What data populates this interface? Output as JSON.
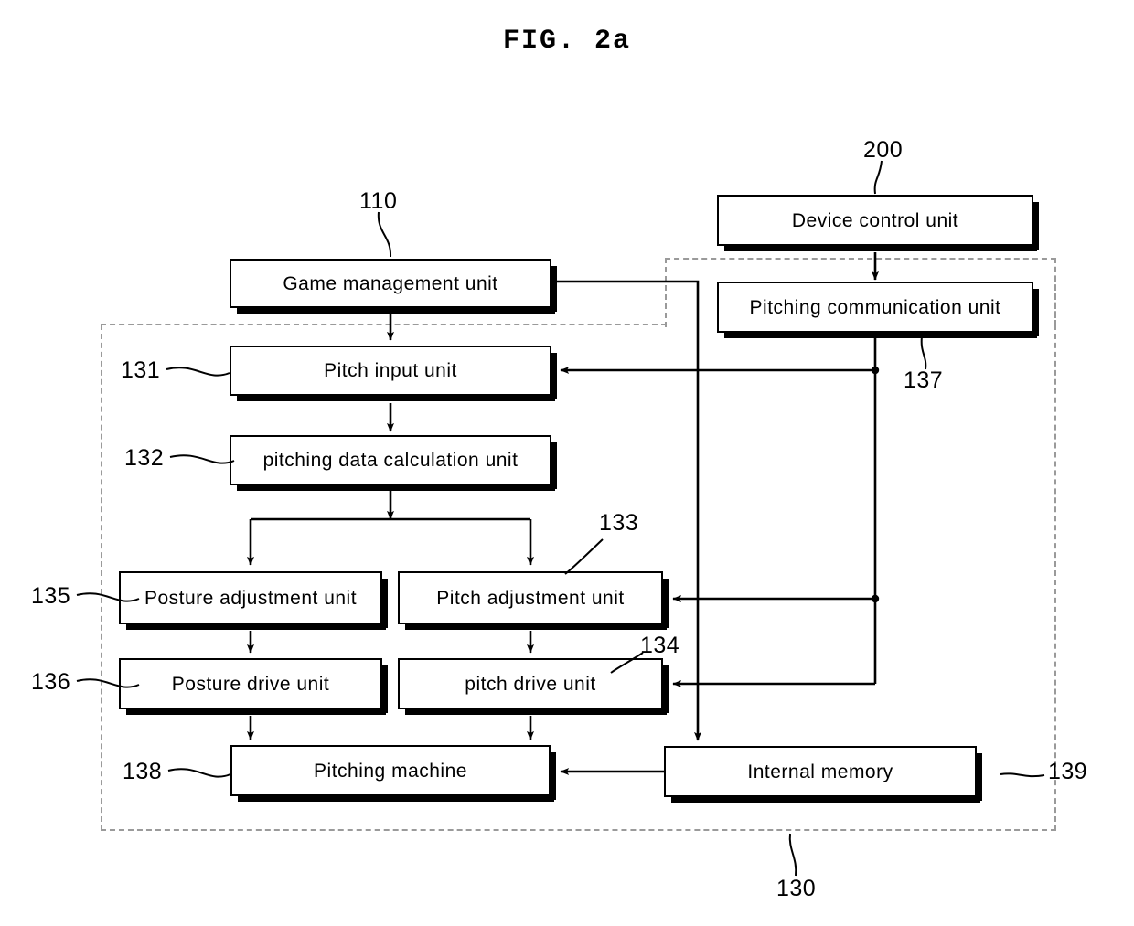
{
  "figure": {
    "title": "FIG. 2a",
    "domain": "patent-block-diagram"
  },
  "colors": {
    "stroke": "#000000",
    "background": "#ffffff",
    "dashed_boundary": "#9a9a9a"
  },
  "boxes": [
    {
      "id": "device_control_unit",
      "label": "Device control unit",
      "ref": "200"
    },
    {
      "id": "pitching_communication",
      "label": "Pitching communication unit",
      "ref": "137"
    },
    {
      "id": "game_management_unit",
      "label": "Game management unit",
      "ref": "110"
    },
    {
      "id": "pitch_input_unit",
      "label": "Pitch input unit",
      "ref": "131"
    },
    {
      "id": "pitching_data_calculation",
      "label": "pitching data calculation unit",
      "ref": "132"
    },
    {
      "id": "posture_adjustment_unit",
      "label": "Posture adjustment unit",
      "ref": "135"
    },
    {
      "id": "pitch_adjustment_unit",
      "label": "Pitch adjustment unit",
      "ref": "133"
    },
    {
      "id": "posture_drive_unit",
      "label": "Posture drive unit",
      "ref": "136"
    },
    {
      "id": "pitch_drive_unit",
      "label": "pitch drive unit",
      "ref": "134"
    },
    {
      "id": "pitching_machine",
      "label": "Pitching machine",
      "ref": "138"
    },
    {
      "id": "internal_memory",
      "label": "Internal memory",
      "ref": "139"
    }
  ],
  "labels": {
    "device_control_unit": "Device control unit",
    "pitching_communication_unit": "Pitching communication unit",
    "game_management_unit": "Game management unit",
    "pitch_input_unit": "Pitch input unit",
    "pitching_data_calculation_unit": "pitching data calculation unit",
    "posture_adjustment_unit": "Posture adjustment unit",
    "pitch_adjustment_unit": "Pitch adjustment unit",
    "posture_drive_unit": "Posture drive unit",
    "pitch_drive_unit": "pitch drive unit",
    "pitching_machine": "Pitching machine",
    "internal_memory": "Internal memory"
  },
  "refs": {
    "device_control_unit": "200",
    "game_management_unit": "110",
    "pitch_input_unit": "131",
    "pitching_data_calculation_unit": "132",
    "pitch_adjustment_unit": "133",
    "pitch_drive_unit": "134",
    "posture_adjustment_unit": "135",
    "posture_drive_unit": "136",
    "pitching_communication_unit": "137",
    "pitching_machine": "138",
    "internal_memory": "139",
    "pitching_device_group": "130"
  },
  "groups": [
    {
      "id": "left_group",
      "ref": "130"
    },
    {
      "id": "right_group",
      "ref": "130"
    }
  ],
  "connections": [
    {
      "from": "game_management_unit",
      "to": "pitch_input_unit",
      "type": "arrow-down"
    },
    {
      "from": "pitch_input_unit",
      "to": "pitching_data_calculation",
      "type": "arrow-down"
    },
    {
      "from": "pitching_data_calculation",
      "to": "posture_adjustment_unit",
      "type": "arrow-branch"
    },
    {
      "from": "pitching_data_calculation",
      "to": "pitch_adjustment_unit",
      "type": "arrow-branch"
    },
    {
      "from": "posture_adjustment_unit",
      "to": "posture_drive_unit",
      "type": "arrow-down"
    },
    {
      "from": "pitch_adjustment_unit",
      "to": "pitch_drive_unit",
      "type": "arrow-down"
    },
    {
      "from": "posture_drive_unit",
      "to": "pitching_machine",
      "type": "arrow-down"
    },
    {
      "from": "pitch_drive_unit",
      "to": "pitching_machine",
      "type": "arrow-down"
    },
    {
      "from": "device_control_unit",
      "to": "pitching_communication",
      "type": "arrow-down"
    },
    {
      "from": "game_management_unit",
      "to": "internal_memory",
      "type": "arrow-route"
    },
    {
      "from": "pitching_communication",
      "to": "pitch_input_unit",
      "type": "arrow-left"
    },
    {
      "from": "pitching_communication",
      "to": "pitch_adjustment_unit",
      "type": "arrow-left"
    },
    {
      "from": "pitching_communication",
      "to": "pitch_drive_unit",
      "type": "arrow-left"
    },
    {
      "from": "internal_memory",
      "to": "pitching_machine",
      "type": "arrow-left"
    }
  ]
}
